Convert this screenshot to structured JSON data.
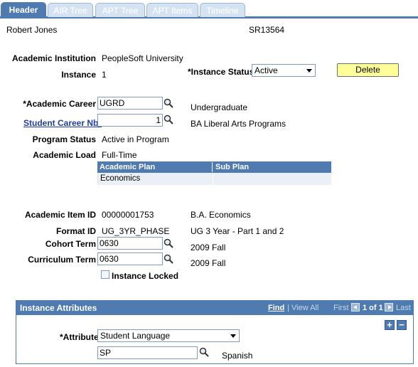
{
  "tabs": [
    {
      "label": "Header",
      "active": true
    },
    {
      "label": "AIR Tree",
      "active": false
    },
    {
      "label": "APT Tree",
      "active": false
    },
    {
      "label": "APT Items",
      "active": false
    },
    {
      "label": "Timeline",
      "active": false
    }
  ],
  "header": {
    "student_name": "Robert Jones",
    "student_id": "SR13564"
  },
  "institution": {
    "label": "Academic Institution",
    "value": "PeopleSoft University"
  },
  "instance": {
    "label": "Instance",
    "value": "1"
  },
  "instance_status": {
    "label": "*Instance Status",
    "value": "Active"
  },
  "delete_button": "Delete",
  "academic_career": {
    "label": "*Academic Career",
    "value": "UGRD",
    "description": "Undergraduate"
  },
  "student_career_nbr": {
    "label": "Student Career Nbr",
    "value": "1",
    "description": "BA Liberal Arts Programs"
  },
  "program_status": {
    "label": "Program Status",
    "value": "Active in Program"
  },
  "academic_load": {
    "label": "Academic Load",
    "value": "Full-Time"
  },
  "plan_grid": {
    "columns": [
      "Academic Plan",
      "Sub Plan"
    ],
    "rows": [
      [
        "Economics",
        ""
      ]
    ]
  },
  "academic_item_id": {
    "label": "Academic Item ID",
    "value": "00000001753",
    "description": "B.A. Economics"
  },
  "format_id": {
    "label": "Format ID",
    "value": "UG_3YR_PHASE",
    "description": "UG 3 Year - Part 1 and 2"
  },
  "cohort_term": {
    "label": "Cohort Term",
    "value": "0630",
    "description": "2009 Fall"
  },
  "curriculum_term": {
    "label": "Curriculum Term",
    "value": "0630",
    "description": "2009 Fall"
  },
  "instance_locked": {
    "label": "Instance Locked",
    "checked": false
  },
  "instance_attributes": {
    "title": "Instance Attributes",
    "find": "Find",
    "view_all": "View All",
    "first": "First",
    "range": "1 of 1",
    "last": "Last",
    "attribute_label": "*Attribute",
    "attribute_value": "Student Language",
    "code_value": "SP",
    "code_description": "Spanish"
  },
  "colors": {
    "tab_active": "#4f7bb0",
    "delete_button": "#ffff99",
    "grid_row": "#ebf0f7"
  }
}
